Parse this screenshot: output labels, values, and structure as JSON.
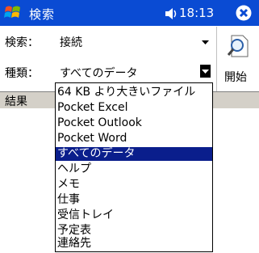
{
  "titlebar": {
    "app_title": "検索",
    "volume_icon": "speaker-icon",
    "volume_glyph": "◀€",
    "time": "18:13",
    "bg_color": "#0a4bd3"
  },
  "form": {
    "search_label": "検索：",
    "search_value": "接続",
    "type_label": "種類：",
    "type_value": "すべてのデータ"
  },
  "search_button": {
    "label": "開始"
  },
  "results": {
    "label": "結果"
  },
  "dropdown": {
    "selected_index": 4,
    "options": [
      "64 KB より大きいファイル",
      "Pocket Excel",
      "Pocket Outlook",
      "Pocket Word",
      "すべてのデータ",
      "ヘルプ",
      "メモ",
      "仕事",
      "受信トレイ",
      "予定表",
      "連絡先"
    ],
    "selection_color": "#0a1e8c"
  }
}
